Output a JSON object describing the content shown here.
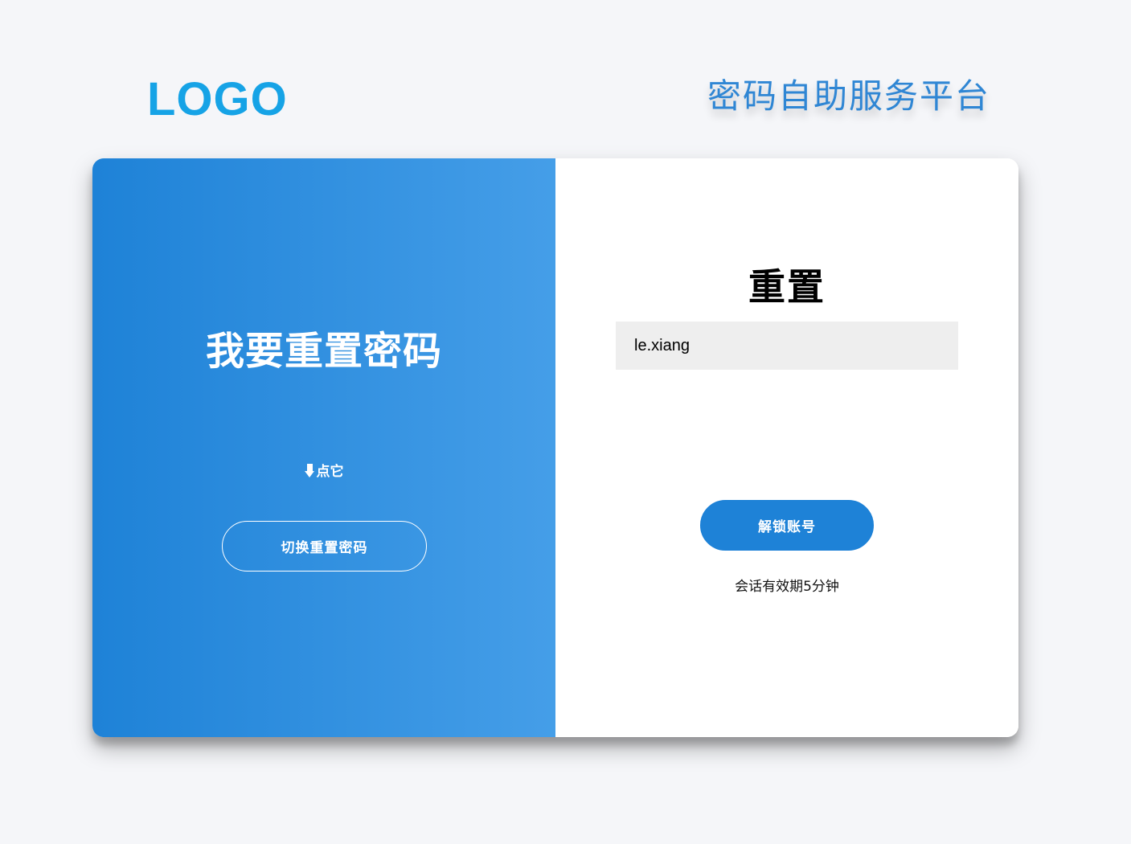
{
  "header": {
    "logo_text": "LOGO",
    "platform_title": "密码自助服务平台"
  },
  "left_panel": {
    "heading": "我要重置密码",
    "hint_text": "点它",
    "hint_icon": "arrow-down-icon",
    "switch_button_label": "切换重置密码"
  },
  "right_panel": {
    "title": "重置",
    "username_value": "le.xiang",
    "unlock_button_label": "解锁账号",
    "session_note": "会话有效期5分钟"
  },
  "colors": {
    "brand_logo": "#16a3e6",
    "title_blue": "#2f86d4",
    "gradient_start": "#1e82d7",
    "gradient_end": "#459ee8",
    "button_blue": "#1e82d7",
    "input_bg": "#eeeeee",
    "page_bg": "#f5f6f9"
  }
}
